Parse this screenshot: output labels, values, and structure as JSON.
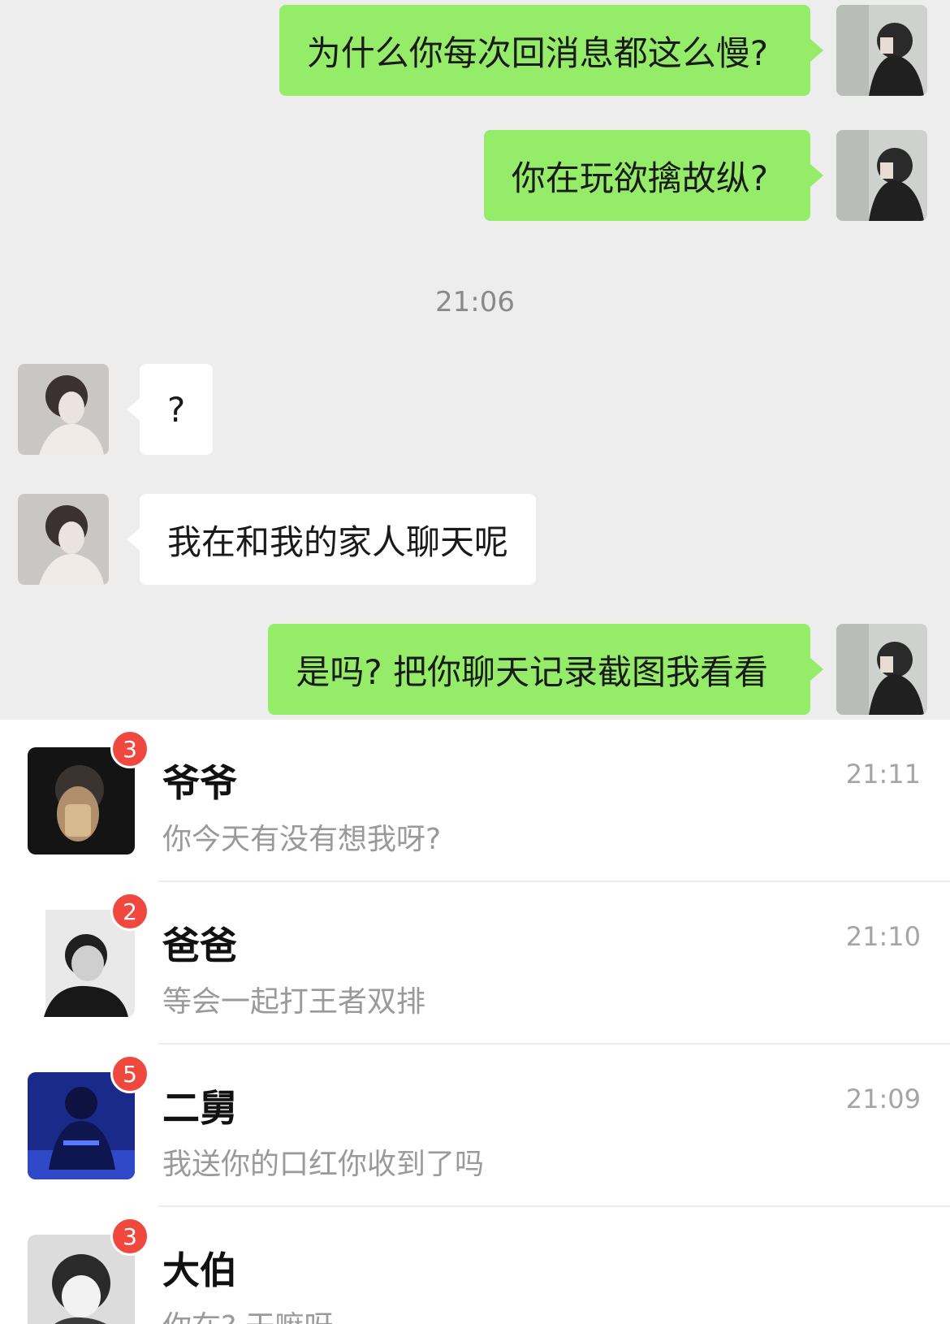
{
  "chat": {
    "messages": [
      {
        "sender": "self",
        "text": "为什么你每次回消息都这么慢?"
      },
      {
        "sender": "self",
        "text": "你在玩欲擒故纵?"
      },
      {
        "sender": "other",
        "text": "?"
      },
      {
        "sender": "other",
        "text": "我在和我的家人聊天呢"
      },
      {
        "sender": "self",
        "text": "是吗? 把你聊天记录截图我看看"
      }
    ],
    "timestamp": "21:06"
  },
  "chat_list": {
    "items": [
      {
        "name": "爷爷",
        "preview": "你今天有没有想我呀?",
        "time": "21:11",
        "unread": "3"
      },
      {
        "name": "爸爸",
        "preview": "等会一起打王者双排",
        "time": "21:10",
        "unread": "2"
      },
      {
        "name": "二舅",
        "preview": "我送你的口红你收到了吗",
        "time": "21:09",
        "unread": "5"
      },
      {
        "name": "大伯",
        "preview": "你在? 干嘛呀",
        "time": "",
        "unread": "3"
      }
    ]
  },
  "colors": {
    "self_bubble": "#95ec69",
    "other_bubble": "#ffffff",
    "chat_background": "#ededed",
    "badge": "#f0483e"
  },
  "icons": {
    "self_avatar": "avatar-photo-person-with-hood",
    "other_avatar": "avatar-photo-woman-portrait"
  }
}
